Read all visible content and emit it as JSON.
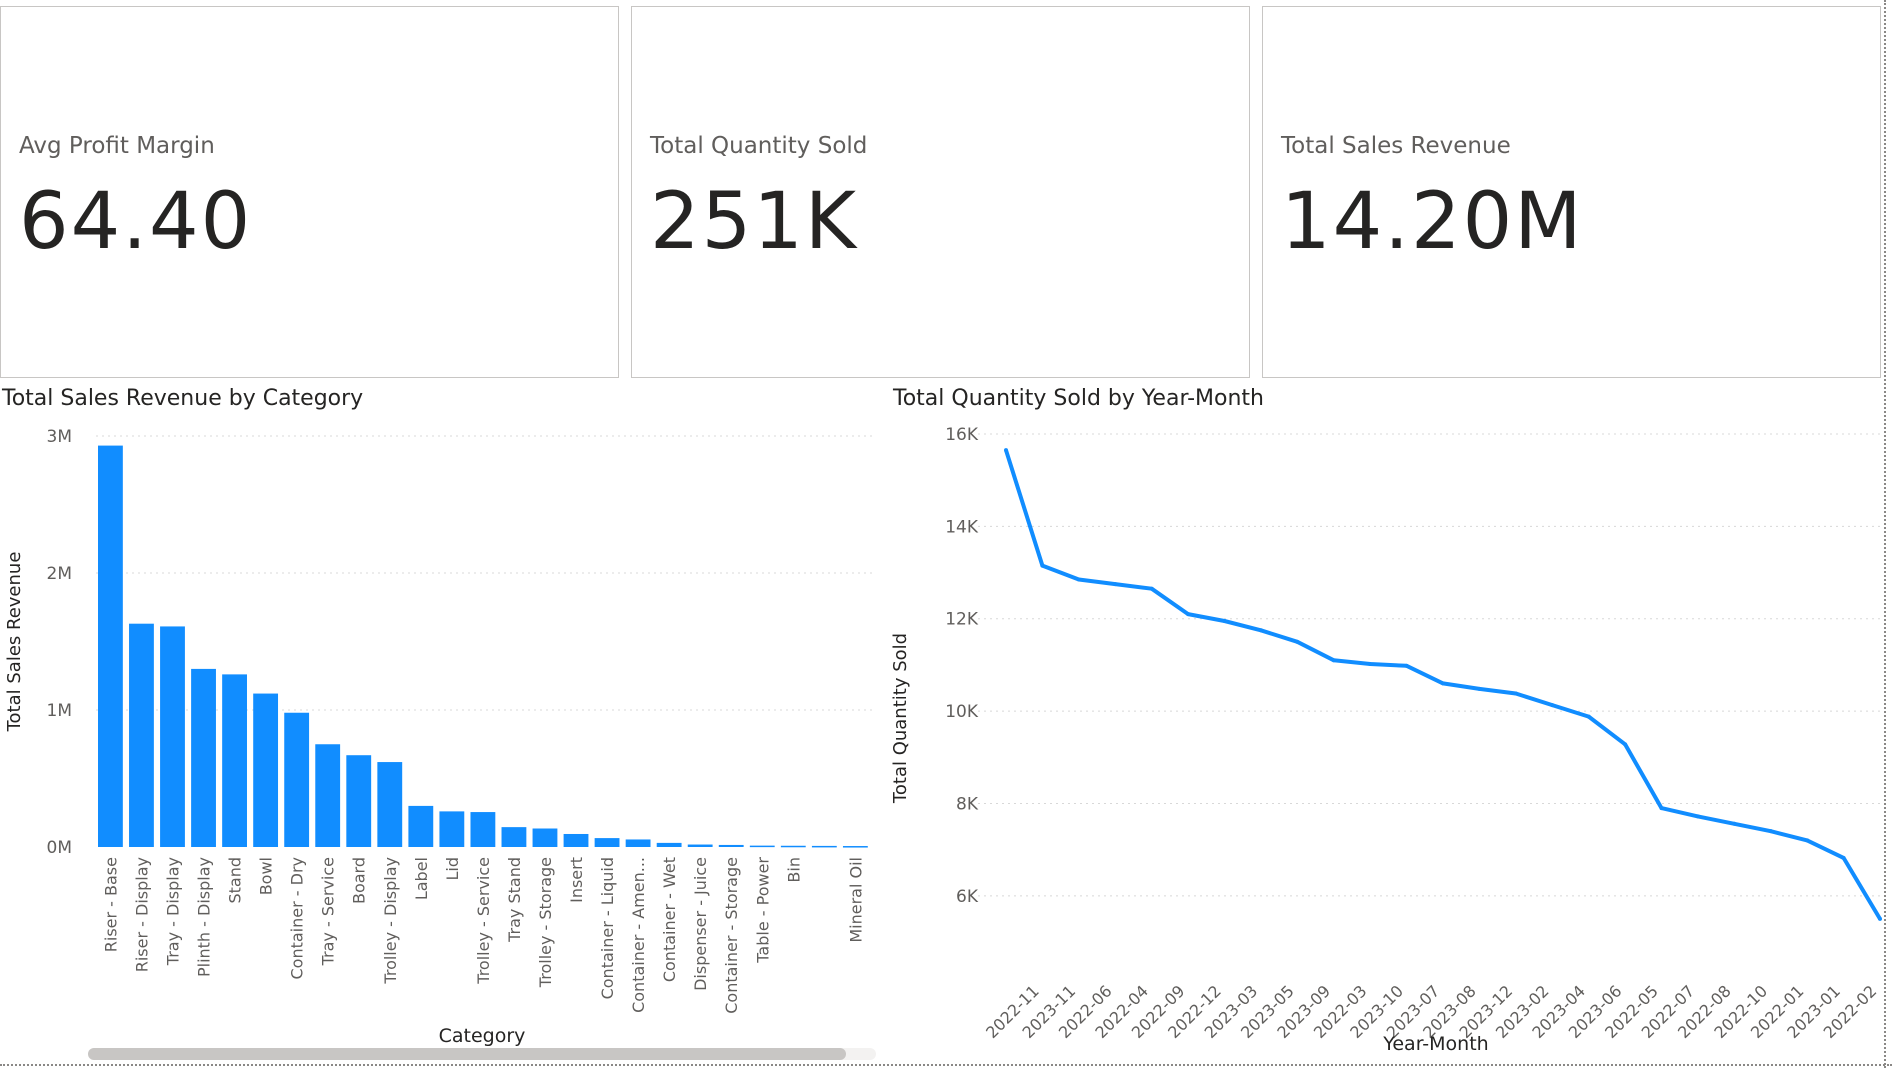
{
  "kpis": [
    {
      "label": "Avg Profit Margin",
      "value": "64.40"
    },
    {
      "label": "Total Quantity Sold",
      "value": "251K"
    },
    {
      "label": "Total Sales Revenue",
      "value": "14.20M"
    }
  ],
  "colors": {
    "accent": "#118DFF",
    "grid": "#d8d8d8",
    "border": "#c8c6c4"
  },
  "chart_data": [
    {
      "type": "bar",
      "title": "Total Sales Revenue by Category",
      "xlabel": "Category",
      "ylabel": "Total Sales Revenue",
      "ylim": [
        0,
        3000000
      ],
      "yticks": [
        "0M",
        "1M",
        "2M",
        "3M"
      ],
      "grid": true,
      "categories": [
        "Riser - Base",
        "Riser - Display",
        "Tray - Display",
        "Plinth - Display",
        "Stand",
        "Bowl",
        "Container - Dry",
        "Tray - Service",
        "Board",
        "Trolley - Display",
        "Label",
        "Lid",
        "Trolley - Service",
        "Tray Stand",
        "Trolley - Storage",
        "Insert",
        "Container - Liquid",
        "Container - Amen...",
        "Container - Wet",
        "Dispenser - Juice",
        "Container - Storage",
        "Table - Power",
        "Bin",
        "",
        "Mineral Oil"
      ],
      "values": [
        2930000,
        1630000,
        1610000,
        1300000,
        1260000,
        1120000,
        980000,
        750000,
        670000,
        620000,
        300000,
        260000,
        255000,
        145000,
        135000,
        95000,
        65000,
        55000,
        30000,
        18000,
        15000,
        10000,
        9000,
        8000,
        7000
      ]
    },
    {
      "type": "line",
      "title": "Total Quantity Sold by Year-Month",
      "xlabel": "Year-Month",
      "ylabel": "Total Quantity Sold",
      "ylim": [
        5000,
        16000
      ],
      "yticks": [
        "6K",
        "8K",
        "10K",
        "12K",
        "14K",
        "16K"
      ],
      "grid": true,
      "categories": [
        "2022-11",
        "2023-11",
        "2022-06",
        "2022-04",
        "2022-09",
        "2022-12",
        "2023-03",
        "2023-05",
        "2023-09",
        "2022-03",
        "2023-10",
        "2023-07",
        "2023-08",
        "2023-12",
        "2023-02",
        "2023-04",
        "2023-06",
        "2022-05",
        "2022-07",
        "2022-08",
        "2022-10",
        "2022-01",
        "2023-01",
        "2022-02"
      ],
      "values": [
        15650,
        13150,
        12850,
        12750,
        12650,
        12100,
        11950,
        11750,
        11500,
        11100,
        11020,
        10980,
        10600,
        10480,
        10380,
        10130,
        9880,
        9280,
        7900,
        7720,
        7560,
        7400,
        7200,
        6820,
        5500
      ]
    }
  ]
}
